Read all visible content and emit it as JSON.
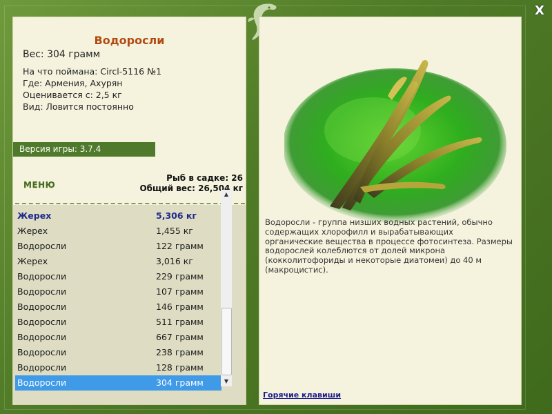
{
  "window": {
    "close_label": "X"
  },
  "left": {
    "fish_name": "Водоросли",
    "fish_weight": "Вес: 304 грамм",
    "info": [
      "На что поймана: Circl-5116 №1",
      "Где: Армения, Ахурян",
      "Оценивается с: 2,5 кг",
      "Вид: Ловится постоянно"
    ],
    "version": "Версия игры: 3.7.4",
    "menu_label": "МЕНЮ",
    "fish_count": "Рыб в садке: 26",
    "total_weight": "Общий вес: 26,504 кг"
  },
  "catch_list": [
    {
      "name": "Жерех",
      "weight": "5,306 кг"
    },
    {
      "name": "Жерех",
      "weight": "1,455 кг"
    },
    {
      "name": "Водоросли",
      "weight": "122 грамм"
    },
    {
      "name": "Жерех",
      "weight": "3,016 кг"
    },
    {
      "name": "Водоросли",
      "weight": "229 грамм"
    },
    {
      "name": "Водоросли",
      "weight": "107 грамм"
    },
    {
      "name": "Водоросли",
      "weight": "146 грамм"
    },
    {
      "name": "Водоросли",
      "weight": "511 грамм"
    },
    {
      "name": "Водоросли",
      "weight": "667 грамм"
    },
    {
      "name": "Водоросли",
      "weight": "238 грамм"
    },
    {
      "name": "Водоросли",
      "weight": "128 грамм"
    },
    {
      "name": "Водоросли",
      "weight": "304 грамм"
    }
  ],
  "right": {
    "image_icon": "algae-picture",
    "description": "Водоросли - группа низших водных растений, обычно содержащих хлорофилл и вырабатывающих органические вещества в процессе фотосинтеза. Размеры водорослей колеблются от долей микрона (кокколитофориды и некоторые диатомеи) до 40 м (макроцистис).",
    "hotkeys_label": "Горячие клавиши"
  },
  "colors": {
    "frame": "#5a8530",
    "panel": "#f5f3de",
    "title": "#b24a12",
    "highlight": "#3f9ae8",
    "version_bar": "#4f7a2c"
  }
}
